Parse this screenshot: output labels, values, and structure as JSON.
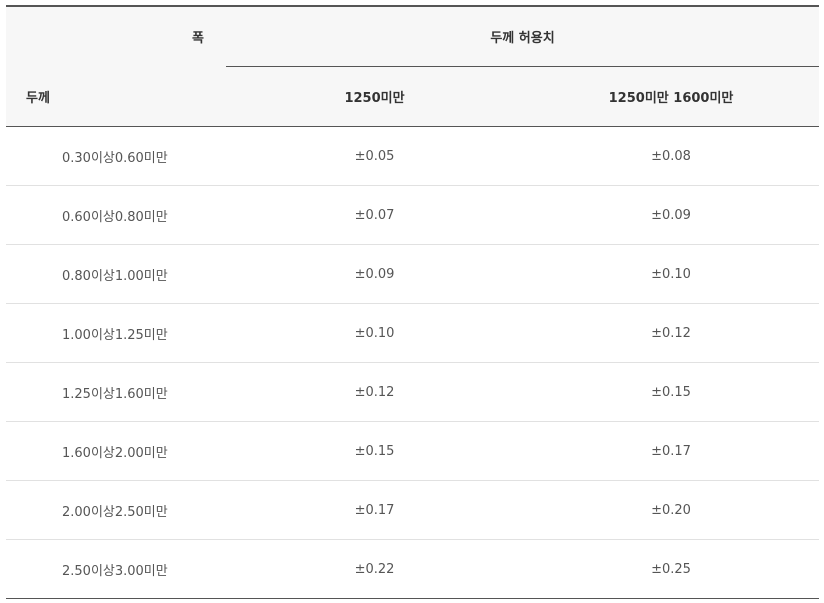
{
  "header": {
    "width_label": "폭",
    "thickness_label": "두께",
    "tolerance_group": "두께 허용치",
    "width_under_1250": "1250미만",
    "width_1250_1600": "1250미만 1600미만"
  },
  "rows": [
    {
      "range": "0.30이상0.60미만",
      "tol_a": "±0.05",
      "tol_b": "±0.08"
    },
    {
      "range": "0.60이상0.80미만",
      "tol_a": "±0.07",
      "tol_b": "±0.09"
    },
    {
      "range": "0.80이상1.00미만",
      "tol_a": "±0.09",
      "tol_b": "±0.10"
    },
    {
      "range": "1.00이상1.25미만",
      "tol_a": "±0.10",
      "tol_b": "±0.12"
    },
    {
      "range": "1.25이상1.60미만",
      "tol_a": "±0.12",
      "tol_b": "±0.15"
    },
    {
      "range": "1.60이상2.00미만",
      "tol_a": "±0.15",
      "tol_b": "±0.17"
    },
    {
      "range": "2.00이상2.50미만",
      "tol_a": "±0.17",
      "tol_b": "±0.20"
    },
    {
      "range": "2.50이상3.00미만",
      "tol_a": "±0.22",
      "tol_b": "±0.25"
    }
  ]
}
